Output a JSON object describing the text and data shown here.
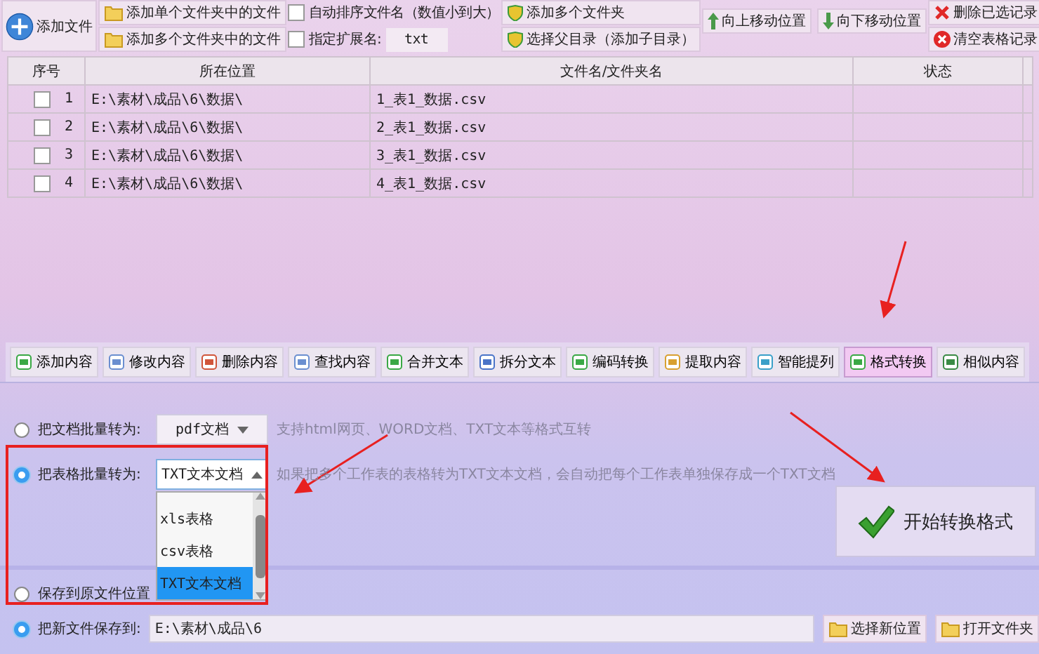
{
  "toolbar": {
    "add_file": "添加文件",
    "col2": [
      "添加单个文件夹中的文件",
      "添加多个文件夹中的文件"
    ],
    "checks": [
      {
        "label": "自动排序文件名（数值小到大）",
        "checked": false
      },
      {
        "label": "指定扩展名:",
        "checked": false
      }
    ],
    "extension": "txt",
    "col4": [
      "添加多个文件夹",
      "选择父目录（添加子目录）"
    ],
    "move": [
      "向上移动位置",
      "向下移动位置"
    ],
    "col6": [
      "删除已选记录",
      "清空表格记录"
    ]
  },
  "table": {
    "columns": [
      "序号",
      "所在位置",
      "文件名/文件夹名",
      "状态"
    ],
    "rows": [
      {
        "checked": false,
        "index": "1",
        "location": "E:\\素材\\成品\\6\\数据\\",
        "name": "1_表1_数据.csv"
      },
      {
        "checked": false,
        "index": "2",
        "location": "E:\\素材\\成品\\6\\数据\\",
        "name": "2_表1_数据.csv"
      },
      {
        "checked": false,
        "index": "3",
        "location": "E:\\素材\\成品\\6\\数据\\",
        "name": "3_表1_数据.csv"
      },
      {
        "checked": false,
        "index": "4",
        "location": "E:\\素材\\成品\\6\\数据\\",
        "name": "4_表1_数据.csv"
      }
    ]
  },
  "tabs": [
    {
      "label": "添加内容",
      "selected": false
    },
    {
      "label": "修改内容",
      "selected": false
    },
    {
      "label": "删除内容",
      "selected": false
    },
    {
      "label": "查找内容",
      "selected": false
    },
    {
      "label": "合并文本",
      "selected": false
    },
    {
      "label": "拆分文本",
      "selected": false
    },
    {
      "label": "编码转换",
      "selected": false
    },
    {
      "label": "提取内容",
      "selected": false
    },
    {
      "label": "智能提列",
      "selected": false
    },
    {
      "label": "格式转换",
      "selected": true
    },
    {
      "label": "相似内容",
      "selected": false
    }
  ],
  "options": [
    {
      "label": "把文档批量转为:",
      "selected": false,
      "value": "pdf文档",
      "open": false,
      "hint": "支持html网页、WORD文档、TXT文本等格式互转"
    },
    {
      "label": "把表格批量转为:",
      "selected": true,
      "value": "TXT文本文档",
      "open": true,
      "hint": "如果把多个工作表的表格转为TXT文本文档，会自动把每个工作表单独保存成一个TXT文档",
      "items": [
        {
          "label": "xls表格",
          "selected": false
        },
        {
          "label": "csv表格",
          "selected": false
        },
        {
          "label": "TXT文本文档",
          "selected": true
        }
      ]
    }
  ],
  "start_button": "开始转换格式",
  "save": [
    {
      "label": "保存到原文件位置",
      "selected": false
    },
    {
      "label": "把新文件保存到:",
      "selected": true,
      "path": "E:\\素材\\成品\\6"
    }
  ],
  "save_buttons": [
    "选择新位置",
    "打开文件夹"
  ]
}
